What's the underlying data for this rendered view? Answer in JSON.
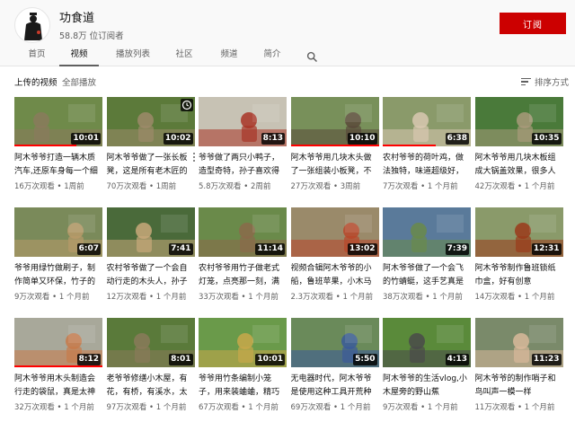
{
  "channel": {
    "name": "功食道",
    "subscribers": "58.8万 位订阅者",
    "subscribe_label": "订阅"
  },
  "tabs": [
    "首页",
    "视频",
    "播放列表",
    "社区",
    "频道",
    "简介"
  ],
  "section": {
    "title": "上传的视频",
    "play_all": "全部播放",
    "sort_label": "排序方式"
  },
  "videos": [
    {
      "title": "阿木爷爷打造一辆木质汽车,还原车身每一个细节",
      "views": "16万次观看",
      "age": "1周前",
      "duration": "10:01",
      "colors": [
        "#6f8a4a",
        "#8a7a5c"
      ],
      "progress": 0.7
    },
    {
      "title": "阿木爷爷做了一张长板凳，这是所有老木匠的必修课",
      "views": "70万次观看",
      "age": "1周前",
      "duration": "10:02",
      "colors": [
        "#5c7a3a",
        "#9c8a6a"
      ],
      "progress": 0.0,
      "clock": true
    },
    {
      "title": "爷爷做了两只小鸭子，造型奇特，孙子喜欢得不得了",
      "views": "5.8万次观看",
      "age": "2周前",
      "duration": "8:13",
      "colors": [
        "#c7c2b4",
        "#a83426"
      ],
      "progress": 0.0
    },
    {
      "title": "阿木爷爷用几块木头做了一张组装小板凳，不用一颗钉子",
      "views": "27万次观看",
      "age": "3周前",
      "duration": "10:10",
      "colors": [
        "#78905a",
        "#5a4a3a"
      ],
      "progress": 1.0
    },
    {
      "title": "农村爷爷的荷叶鸡，做法独特，味道超级好，孩子都爱吃",
      "views": "7万次观看",
      "age": "1 个月前",
      "duration": "6:38",
      "colors": [
        "#8a9a6a",
        "#d8c8b0"
      ],
      "progress": 0.6
    },
    {
      "title": "阿木爷爷用几块木板组成大锅盖效果，很多人看不懂",
      "views": "42万次观看",
      "age": "1 个月前",
      "duration": "10:35",
      "colors": [
        "#4a7a3a",
        "#a89a7a"
      ],
      "progress": 0.0
    },
    {
      "title": "爷爷用绿竹做刷子，制作简单又环保，竹子的妙用",
      "views": "9万次观看",
      "age": "1 个月前",
      "duration": "6:07",
      "colors": [
        "#7a8a5a",
        "#b89a6a"
      ],
      "progress": 0.0
    },
    {
      "title": "农村爷爷做了一个会自动行走的木头人，孙子开心极了",
      "views": "12万次观看",
      "age": "1 个月前",
      "duration": "7:41",
      "colors": [
        "#4a6a3a",
        "#c8a87a"
      ],
      "progress": 0.0
    },
    {
      "title": "农村爷爷用竹子做老式灯笼，点亮那一刻，满满的回忆",
      "views": "33万次观看",
      "age": "1 个月前",
      "duration": "11:14",
      "colors": [
        "#6a8a4a",
        "#8a6a4a"
      ],
      "progress": 0.0
    },
    {
      "title": "视频合辑阿木爷爷的小船，鲁班苹果，小木马大集合",
      "views": "2.3万次观看",
      "age": "1 个月前",
      "duration": "13:02",
      "colors": [
        "#9a8a6a",
        "#b8462a"
      ],
      "progress": 0.0
    },
    {
      "title": "阿木爷爷做了一个会飞的竹蜻蜓，这手艺真是绝了",
      "views": "38万次观看",
      "age": "1 个月前",
      "duration": "7:39",
      "colors": [
        "#5a7a9a",
        "#6a8a4a"
      ],
      "progress": 0.0
    },
    {
      "title": "阿木爷爷制作鲁班锁纸巾盒，好有创意",
      "views": "14万次观看",
      "age": "1 个月前",
      "duration": "12:31",
      "colors": [
        "#8a9a6a",
        "#9a3a1a"
      ],
      "progress": 0.0
    },
    {
      "title": "阿木爷爷用木头制造会行走的袋鼠，真是太神奇了",
      "views": "32万次观看",
      "age": "1 个月前",
      "duration": "8:12",
      "colors": [
        "#a8a89a",
        "#c87a4a"
      ],
      "progress": 1.0
    },
    {
      "title": "老爷爷修缮小木屋，有花，有桥，有溪水，太美了",
      "views": "97万次观看",
      "age": "1 个月前",
      "duration": "8:01",
      "colors": [
        "#5a7a3a",
        "#8a7a5a"
      ],
      "progress": 0.0
    },
    {
      "title": "爷爷用竹条编制小笼子，用来装蛐蛐，精巧又实用",
      "views": "67万次观看",
      "age": "1 个月前",
      "duration": "10:01",
      "colors": [
        "#6a9a4a",
        "#c8a84a"
      ],
      "progress": 0.0
    },
    {
      "title": "无电器时代，阿木爷爷是使用这种工具开荒种地的",
      "views": "69万次观看",
      "age": "1 个月前",
      "duration": "5:50",
      "colors": [
        "#6a8a5a",
        "#3a5a9a"
      ],
      "progress": 0.0
    },
    {
      "title": "阿木爷爷的生活vlog,小木屋旁的野山蕉",
      "views": "9万次观看",
      "age": "1 个月前",
      "duration": "4:13",
      "colors": [
        "#5a8a3a",
        "#4a4a4a"
      ],
      "progress": 0.0
    },
    {
      "title": "阿木爷爷的制作哨子和鸟叫声一模一样",
      "views": "11万次观看",
      "age": "1 个月前",
      "duration": "11:23",
      "colors": [
        "#7a8a6a",
        "#d8b89a"
      ],
      "progress": 0.0
    }
  ]
}
